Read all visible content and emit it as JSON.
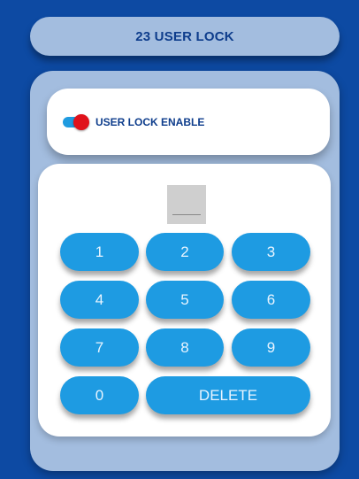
{
  "header": {
    "title": "23 USER LOCK"
  },
  "toggle": {
    "label": "USER LOCK ENABLE",
    "state": "on",
    "track_color": "#1f9be0",
    "knob_color": "#e0121b"
  },
  "keypad": {
    "keys": [
      "1",
      "2",
      "3",
      "4",
      "5",
      "6",
      "7",
      "8",
      "9",
      "0"
    ],
    "delete_label": "DELETE"
  },
  "colors": {
    "background": "#0d4aa3",
    "panel": "#a3bddf",
    "key": "#1e9be2",
    "title_text": "#0e3d8c"
  }
}
